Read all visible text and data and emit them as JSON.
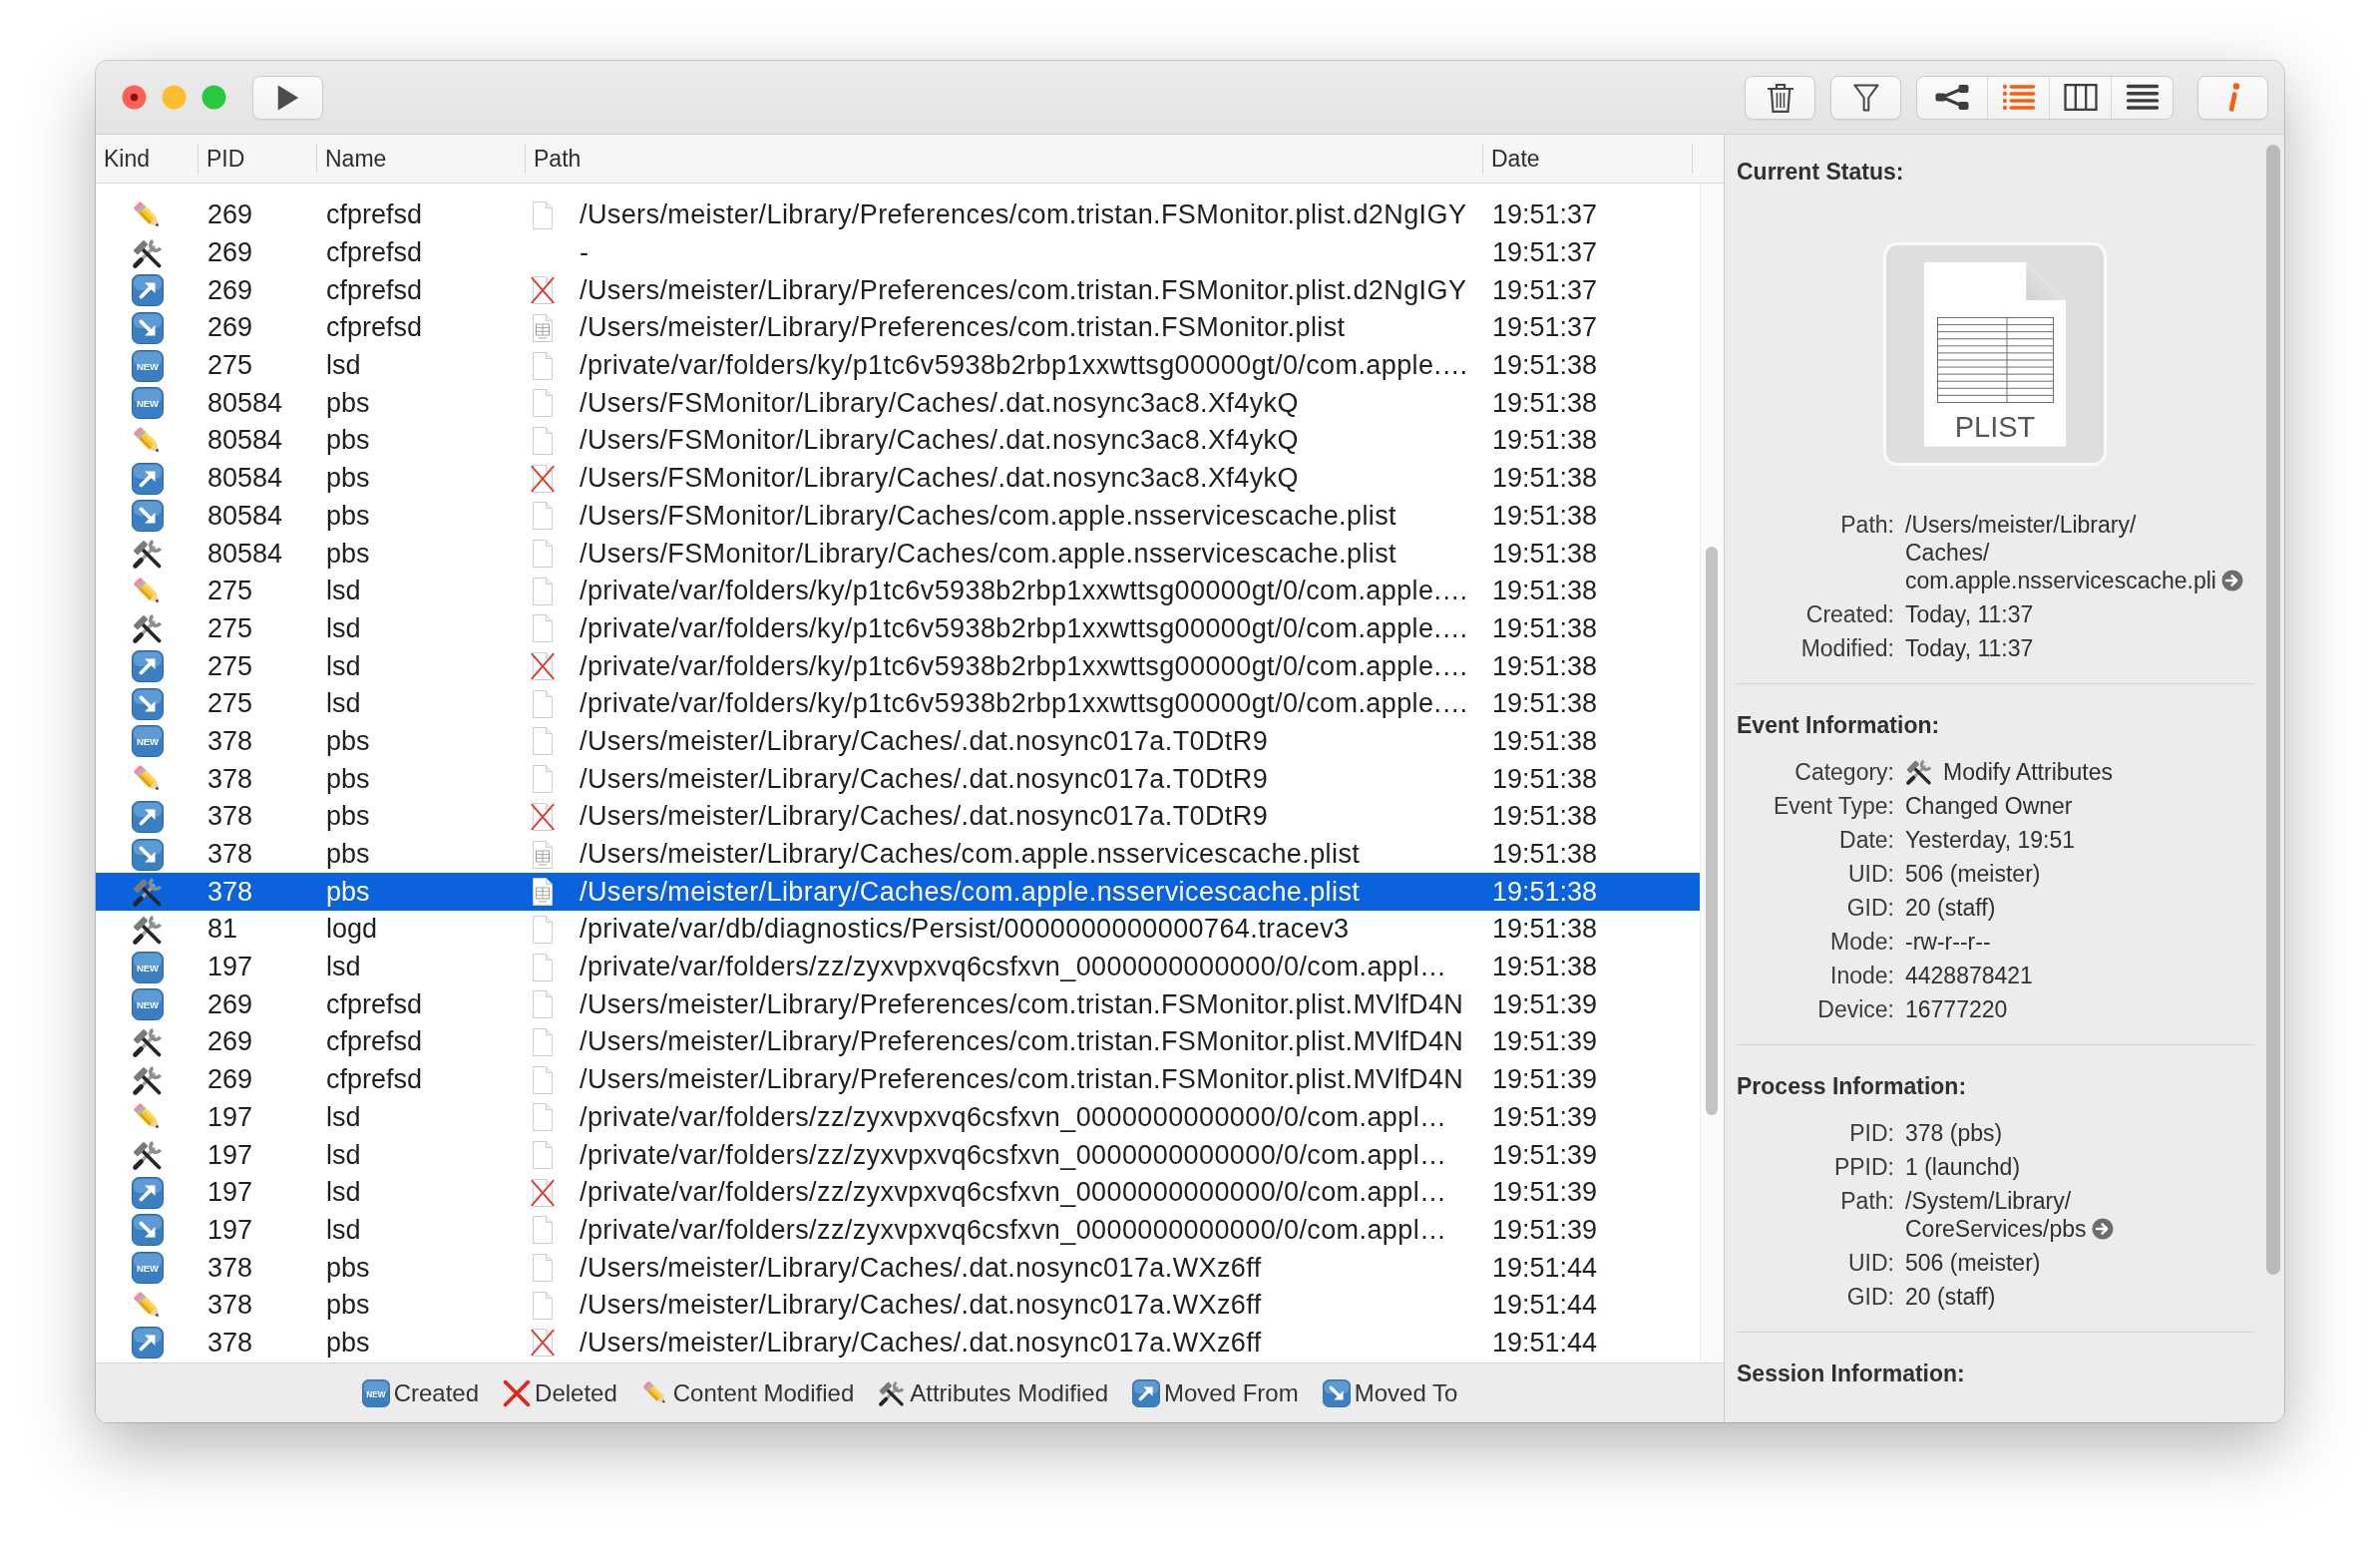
{
  "toolbar": {
    "view_modes": [
      {
        "kind": "graph",
        "selected": false
      },
      {
        "kind": "list",
        "selected": true
      },
      {
        "kind": "columns",
        "selected": false
      },
      {
        "kind": "text",
        "selected": false
      }
    ],
    "inspector": {
      "on": true
    }
  },
  "table": {
    "columns": [
      "Kind",
      "PID",
      "Name",
      "Path",
      "Date"
    ],
    "rows": [
      {
        "kind": "modified",
        "pid": "269",
        "name": "cfprefsd",
        "file": {
          "kind": "document"
        },
        "path": "/Users/meister/Library/Preferences/com.tristan.FSMonitor.plist.d2NgIGY",
        "date": "19:51:37",
        "selected": false
      },
      {
        "kind": "attributes",
        "pid": "269",
        "name": "cfprefsd",
        "path": "-",
        "date": "19:51:37",
        "selected": false
      },
      {
        "kind": "moved_from",
        "pid": "269",
        "name": "cfprefsd",
        "file": {
          "kind": "missing"
        },
        "path": "/Users/meister/Library/Preferences/com.tristan.FSMonitor.plist.d2NgIGY",
        "date": "19:51:37",
        "selected": false
      },
      {
        "kind": "moved_to",
        "pid": "269",
        "name": "cfprefsd",
        "file": {
          "kind": "plist"
        },
        "path": "/Users/meister/Library/Preferences/com.tristan.FSMonitor.plist",
        "date": "19:51:37",
        "selected": false
      },
      {
        "kind": "created",
        "badge": "NEW",
        "pid": "275",
        "name": "lsd",
        "file": {
          "kind": "document"
        },
        "path": "/private/var/folders/ky/p1tc6v5938b2rbp1xxwttsg00000gt/0/com.apple.…",
        "date": "19:51:38",
        "selected": false
      },
      {
        "kind": "created",
        "badge": "NEW",
        "pid": "80584",
        "name": "pbs",
        "file": {
          "kind": "document"
        },
        "path": "/Users/FSMonitor/Library/Caches/.dat.nosync3ac8.Xf4ykQ",
        "date": "19:51:38",
        "selected": false
      },
      {
        "kind": "modified",
        "pid": "80584",
        "name": "pbs",
        "file": {
          "kind": "document"
        },
        "path": "/Users/FSMonitor/Library/Caches/.dat.nosync3ac8.Xf4ykQ",
        "date": "19:51:38",
        "selected": false
      },
      {
        "kind": "moved_from",
        "pid": "80584",
        "name": "pbs",
        "file": {
          "kind": "missing"
        },
        "path": "/Users/FSMonitor/Library/Caches/.dat.nosync3ac8.Xf4ykQ",
        "date": "19:51:38",
        "selected": false
      },
      {
        "kind": "moved_to",
        "pid": "80584",
        "name": "pbs",
        "file": {
          "kind": "document"
        },
        "path": "/Users/FSMonitor/Library/Caches/com.apple.nsservicescache.plist",
        "date": "19:51:38",
        "selected": false
      },
      {
        "kind": "attributes",
        "pid": "80584",
        "name": "pbs",
        "file": {
          "kind": "document"
        },
        "path": "/Users/FSMonitor/Library/Caches/com.apple.nsservicescache.plist",
        "date": "19:51:38",
        "selected": false
      },
      {
        "kind": "modified",
        "pid": "275",
        "name": "lsd",
        "file": {
          "kind": "document"
        },
        "path": "/private/var/folders/ky/p1tc6v5938b2rbp1xxwttsg00000gt/0/com.apple.…",
        "date": "19:51:38",
        "selected": false
      },
      {
        "kind": "attributes",
        "pid": "275",
        "name": "lsd",
        "file": {
          "kind": "document"
        },
        "path": "/private/var/folders/ky/p1tc6v5938b2rbp1xxwttsg00000gt/0/com.apple.…",
        "date": "19:51:38",
        "selected": false
      },
      {
        "kind": "moved_from",
        "pid": "275",
        "name": "lsd",
        "file": {
          "kind": "missing"
        },
        "path": "/private/var/folders/ky/p1tc6v5938b2rbp1xxwttsg00000gt/0/com.apple.…",
        "date": "19:51:38",
        "selected": false
      },
      {
        "kind": "moved_to",
        "pid": "275",
        "name": "lsd",
        "file": {
          "kind": "document"
        },
        "path": "/private/var/folders/ky/p1tc6v5938b2rbp1xxwttsg00000gt/0/com.apple.…",
        "date": "19:51:38",
        "selected": false
      },
      {
        "kind": "created",
        "badge": "NEW",
        "pid": "378",
        "name": "pbs",
        "file": {
          "kind": "document"
        },
        "path": "/Users/meister/Library/Caches/.dat.nosync017a.T0DtR9",
        "date": "19:51:38",
        "selected": false
      },
      {
        "kind": "modified",
        "pid": "378",
        "name": "pbs",
        "file": {
          "kind": "document"
        },
        "path": "/Users/meister/Library/Caches/.dat.nosync017a.T0DtR9",
        "date": "19:51:38",
        "selected": false
      },
      {
        "kind": "moved_from",
        "pid": "378",
        "name": "pbs",
        "file": {
          "kind": "missing"
        },
        "path": "/Users/meister/Library/Caches/.dat.nosync017a.T0DtR9",
        "date": "19:51:38",
        "selected": false
      },
      {
        "kind": "moved_to",
        "pid": "378",
        "name": "pbs",
        "file": {
          "kind": "plist"
        },
        "path": "/Users/meister/Library/Caches/com.apple.nsservicescache.plist",
        "date": "19:51:38",
        "selected": false
      },
      {
        "kind": "attributes",
        "pid": "378",
        "name": "pbs",
        "file": {
          "kind": "plist"
        },
        "path": "/Users/meister/Library/Caches/com.apple.nsservicescache.plist",
        "date": "19:51:38",
        "selected": true
      },
      {
        "kind": "attributes",
        "pid": "81",
        "name": "logd",
        "file": {
          "kind": "document"
        },
        "path": "/private/var/db/diagnostics/Persist/0000000000000764.tracev3",
        "date": "19:51:38",
        "selected": false
      },
      {
        "kind": "created",
        "badge": "NEW",
        "pid": "197",
        "name": "lsd",
        "file": {
          "kind": "document"
        },
        "path": "/private/var/folders/zz/zyxvpxvq6csfxvn_0000000000000/0/com.appl…",
        "date": "19:51:38",
        "selected": false
      },
      {
        "kind": "created",
        "badge": "NEW",
        "pid": "269",
        "name": "cfprefsd",
        "file": {
          "kind": "document"
        },
        "path": "/Users/meister/Library/Preferences/com.tristan.FSMonitor.plist.MVlfD4N",
        "date": "19:51:39",
        "selected": false
      },
      {
        "kind": "attributes",
        "pid": "269",
        "name": "cfprefsd",
        "file": {
          "kind": "document"
        },
        "path": "/Users/meister/Library/Preferences/com.tristan.FSMonitor.plist.MVlfD4N",
        "date": "19:51:39",
        "selected": false
      },
      {
        "kind": "attributes",
        "pid": "269",
        "name": "cfprefsd",
        "file": {
          "kind": "document"
        },
        "path": "/Users/meister/Library/Preferences/com.tristan.FSMonitor.plist.MVlfD4N",
        "date": "19:51:39",
        "selected": false
      },
      {
        "kind": "modified",
        "pid": "197",
        "name": "lsd",
        "file": {
          "kind": "document"
        },
        "path": "/private/var/folders/zz/zyxvpxvq6csfxvn_0000000000000/0/com.appl…",
        "date": "19:51:39",
        "selected": false
      },
      {
        "kind": "attributes",
        "pid": "197",
        "name": "lsd",
        "file": {
          "kind": "document"
        },
        "path": "/private/var/folders/zz/zyxvpxvq6csfxvn_0000000000000/0/com.appl…",
        "date": "19:51:39",
        "selected": false
      },
      {
        "kind": "moved_from",
        "pid": "197",
        "name": "lsd",
        "file": {
          "kind": "missing"
        },
        "path": "/private/var/folders/zz/zyxvpxvq6csfxvn_0000000000000/0/com.appl…",
        "date": "19:51:39",
        "selected": false
      },
      {
        "kind": "moved_to",
        "pid": "197",
        "name": "lsd",
        "file": {
          "kind": "document"
        },
        "path": "/private/var/folders/zz/zyxvpxvq6csfxvn_0000000000000/0/com.appl…",
        "date": "19:51:39",
        "selected": false
      },
      {
        "kind": "created",
        "badge": "NEW",
        "pid": "378",
        "name": "pbs",
        "file": {
          "kind": "document"
        },
        "path": "/Users/meister/Library/Caches/.dat.nosync017a.WXz6ff",
        "date": "19:51:44",
        "selected": false
      },
      {
        "kind": "modified",
        "pid": "378",
        "name": "pbs",
        "file": {
          "kind": "document"
        },
        "path": "/Users/meister/Library/Caches/.dat.nosync017a.WXz6ff",
        "date": "19:51:44",
        "selected": false
      },
      {
        "kind": "moved_from",
        "pid": "378",
        "name": "pbs",
        "file": {
          "kind": "missing"
        },
        "path": "/Users/meister/Library/Caches/.dat.nosync017a.WXz6ff",
        "date": "19:51:44",
        "selected": false
      }
    ]
  },
  "legend": [
    {
      "kind": "created",
      "badge": "NEW",
      "label": "Created"
    },
    {
      "kind": "deleted",
      "label": "Deleted"
    },
    {
      "kind": "modified",
      "label": "Content Modified"
    },
    {
      "kind": "attributes",
      "label": "Attributes Modified"
    },
    {
      "kind": "moved_from",
      "label": "Moved From"
    },
    {
      "kind": "moved_to",
      "label": "Moved To"
    }
  ],
  "inspector": {
    "sections": [
      {
        "title": "Current Status:",
        "preview": {
          "kind": "plist",
          "label": "PLIST"
        },
        "fields": [
          {
            "label": "Path:",
            "lines": [
              "/Users/meister/Library/",
              "Caches/",
              "com.apple.nsservicescache.pli"
            ],
            "reveal": true
          },
          {
            "label": "Created:",
            "value": "Today, 11:37"
          },
          {
            "label": "Modified:",
            "value": "Today, 11:37"
          }
        ]
      },
      {
        "title": "Event Information:",
        "fields": [
          {
            "label": "Category:",
            "icon": {
              "kind": "attributes"
            },
            "value": "Modify Attributes"
          },
          {
            "label": "Event Type:",
            "value": "Changed Owner"
          },
          {
            "label": "Date:",
            "value": "Yesterday, 19:51"
          },
          {
            "label": "UID:",
            "value": "506 (meister)"
          },
          {
            "label": "GID:",
            "value": "20 (staff)"
          },
          {
            "label": "Mode:",
            "value": "-rw-r--r--"
          },
          {
            "label": "Inode:",
            "value": "4428878421"
          },
          {
            "label": "Device:",
            "value": "16777220"
          }
        ]
      },
      {
        "title": "Process Information:",
        "fields": [
          {
            "label": "PID:",
            "value": "378 (pbs)"
          },
          {
            "label": "PPID:",
            "value": "1 (launchd)"
          },
          {
            "label": "Path:",
            "lines": [
              "/System/Library/",
              "CoreServices/pbs"
            ],
            "reveal": true
          },
          {
            "label": "UID:",
            "value": "506 (meister)"
          },
          {
            "label": "GID:",
            "value": "20 (staff)"
          }
        ]
      },
      {
        "title": "Session Information:"
      }
    ]
  }
}
